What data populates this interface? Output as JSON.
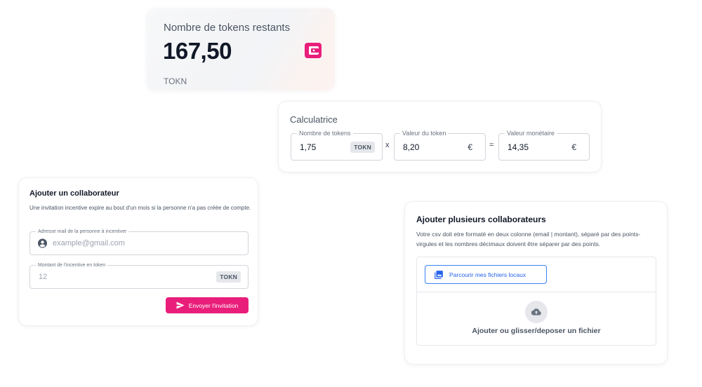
{
  "balance": {
    "title": "Nombre de tokens restants",
    "amount": "167,50",
    "unit": "TOKN",
    "icon": "wallet-icon",
    "accent": "#e91e7a"
  },
  "calculator": {
    "title": "Calculatrice",
    "tokens": {
      "label": "Nombre de tokens",
      "value": "1,75",
      "badge": "TOKN"
    },
    "multiply": "x",
    "token_value": {
      "label": "Valeur du token",
      "value": "8,20",
      "currency": "€"
    },
    "equals": "=",
    "monetary_value": {
      "label": "Valeur monétaire",
      "value": "14,35",
      "currency": "€"
    }
  },
  "add_one": {
    "title": "Ajouter un collaborateur",
    "description": "Une invitation incentive expire au bout d'un mois si la personne n'a pas créée de compte.",
    "email": {
      "label": "Adresse mail de la personne à incentiver",
      "placeholder": "example@gmail.com",
      "icon": "account-circle-icon"
    },
    "amount": {
      "label": "Montant de l'incentive en token",
      "placeholder": "12",
      "badge": "TOKN"
    },
    "send_button": "Envoyer l'invitation",
    "send_icon": "send-icon"
  },
  "add_many": {
    "title": "Ajouter plusieurs collaborateurs",
    "description": "Votre csv doit etre formaté en deux colonne (email | montant), séparé par des points-virgules et les nombres décimaux doivent être séparer par des points.",
    "browse_button": "Parcourir mes fichiers locaux",
    "browse_icon": "photo-library-icon",
    "drop_icon": "cloud-upload-icon",
    "drop_text": "Ajouter ou glisser/deposer un fichier",
    "accent": "#2563eb"
  }
}
